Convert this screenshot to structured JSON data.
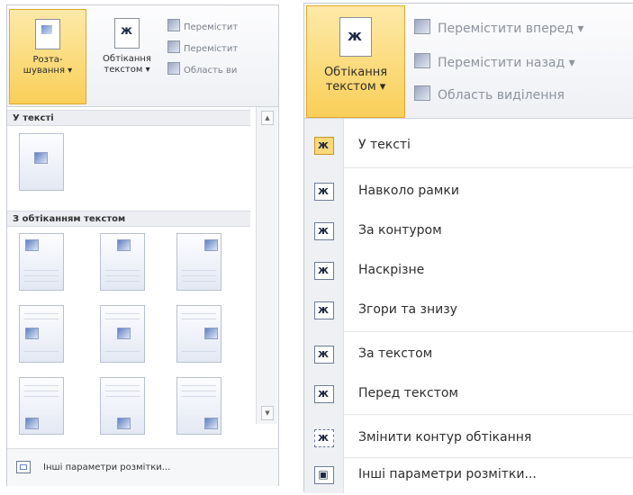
{
  "left": {
    "ribbon": {
      "position_btn": "Розта-\nшування ▾",
      "wrap_btn": "Обтікання\nтекстом ▾",
      "small": [
        "Перемістит",
        "Перемістит",
        "Область ви"
      ]
    },
    "sections": {
      "in_text": "У тексті",
      "with_wrap": "З обтіканням текстом"
    },
    "footer": "Інші параметри розмітки..."
  },
  "right": {
    "ribbon": {
      "wrap_btn_line1": "Обтікання",
      "wrap_btn_line2": "текстом ▾",
      "bring_forward": "Перемістити вперед ▾",
      "send_backward": "Перемістити назад ▾",
      "selection_pane": "Область виділення"
    },
    "menu": [
      {
        "label": "У тексті",
        "glyph": "ж",
        "active": true
      },
      {
        "label": "Навколо рамки",
        "glyph": "ж",
        "active": false
      },
      {
        "label": "За контуром",
        "glyph": "ж",
        "active": false
      },
      {
        "label": "Наскрізне",
        "glyph": "ж",
        "active": false
      },
      {
        "label": "Згори та знизу",
        "glyph": "ж",
        "active": false
      },
      {
        "label": "За текстом",
        "glyph": "ж",
        "active": false
      },
      {
        "label": "Перед текстом",
        "glyph": "ж",
        "active": false
      },
      {
        "label": "Змінити контур обтікання",
        "glyph": "ж",
        "active": false
      },
      {
        "label": "Інші параметри розмітки...",
        "glyph": "▣",
        "active": false
      }
    ]
  }
}
